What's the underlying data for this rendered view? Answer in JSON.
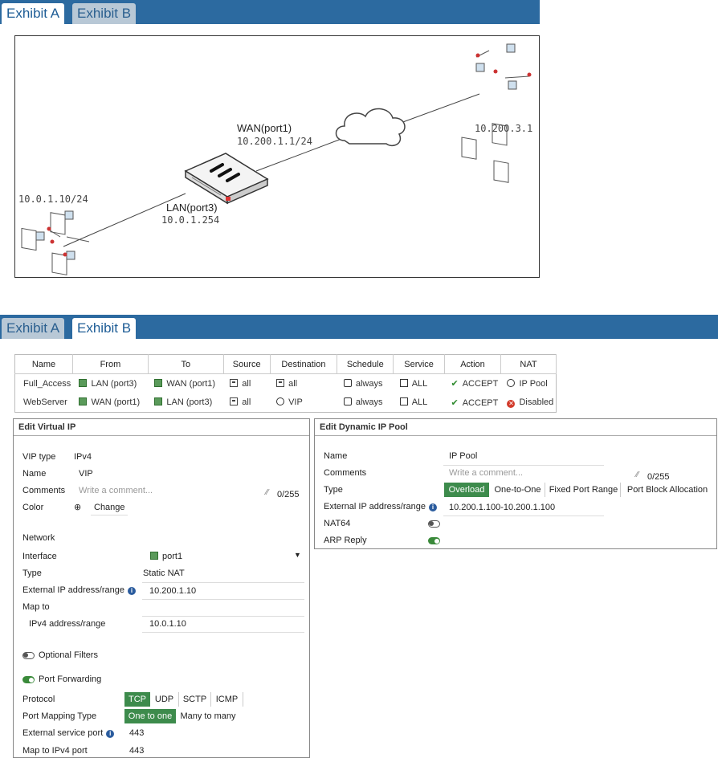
{
  "exhibit_a_tabs": [
    "Exhibit A",
    "Exhibit B"
  ],
  "exhibit_b_tabs": [
    "Exhibit A",
    "Exhibit B"
  ],
  "diagram": {
    "wan_label": "WAN(port1)",
    "wan_ip": "10.200.1.1/24",
    "lan_label": "LAN(port3)",
    "lan_ip": "10.0.1.254",
    "left_net": "10.0.1.10/24",
    "right_net": "10.200.3.1"
  },
  "policy": {
    "headers": [
      "Name",
      "From",
      "To",
      "Source",
      "Destination",
      "Schedule",
      "Service",
      "Action",
      "NAT"
    ],
    "rows": [
      {
        "name": "Full_Access",
        "from": "LAN (port3)",
        "to": "WAN (port1)",
        "source": "all",
        "destination": "all",
        "schedule": "always",
        "service": "ALL",
        "action": "ACCEPT",
        "nat": "IP Pool"
      },
      {
        "name": "WebServer",
        "from": "WAN (port1)",
        "to": "LAN (port3)",
        "source": "all",
        "destination": "VIP",
        "schedule": "always",
        "service": "ALL",
        "action": "ACCEPT",
        "nat": "Disabled"
      }
    ]
  },
  "vip": {
    "title": "Edit Virtual IP",
    "vip_type_label": "VIP type",
    "vip_type": "IPv4",
    "name_label": "Name",
    "name": "VIP",
    "comments_label": "Comments",
    "comments_placeholder": "Write a comment...",
    "comment_count": "0/255",
    "color_label": "Color",
    "color_change": "Change",
    "network_label": "Network",
    "interface_label": "Interface",
    "interface": "port1",
    "type_label": "Type",
    "type": "Static NAT",
    "ext_ip_label": "External IP address/range",
    "ext_ip": "10.200.1.10",
    "map_to_label": "Map to",
    "ipv4_label": "IPv4 address/range",
    "ipv4": "10.0.1.10",
    "optional_filters": "Optional Filters",
    "port_forwarding": "Port Forwarding",
    "protocol_label": "Protocol",
    "protocols": [
      "TCP",
      "UDP",
      "SCTP",
      "ICMP"
    ],
    "mapping_label": "Port Mapping Type",
    "mappings": [
      "One to one",
      "Many to many"
    ],
    "ext_port_label": "External service port",
    "ext_port": "443",
    "map_port_label": "Map to IPv4 port",
    "map_port": "443"
  },
  "pool": {
    "title": "Edit Dynamic IP Pool",
    "name_label": "Name",
    "name": "IP Pool",
    "comments_label": "Comments",
    "comments_placeholder": "Write a comment...",
    "comment_count": "0/255",
    "type_label": "Type",
    "types": [
      "Overload",
      "One-to-One",
      "Fixed Port Range",
      "Port Block Allocation"
    ],
    "ext_ip_label": "External IP address/range",
    "ext_ip": "10.200.1.100-10.200.1.100",
    "nat64_label": "NAT64",
    "arp_label": "ARP Reply"
  },
  "colors": {
    "tab_bar": "#2c6aa0",
    "selected_green": "#3d8b4c",
    "info_blue": "#2b5c9e"
  }
}
